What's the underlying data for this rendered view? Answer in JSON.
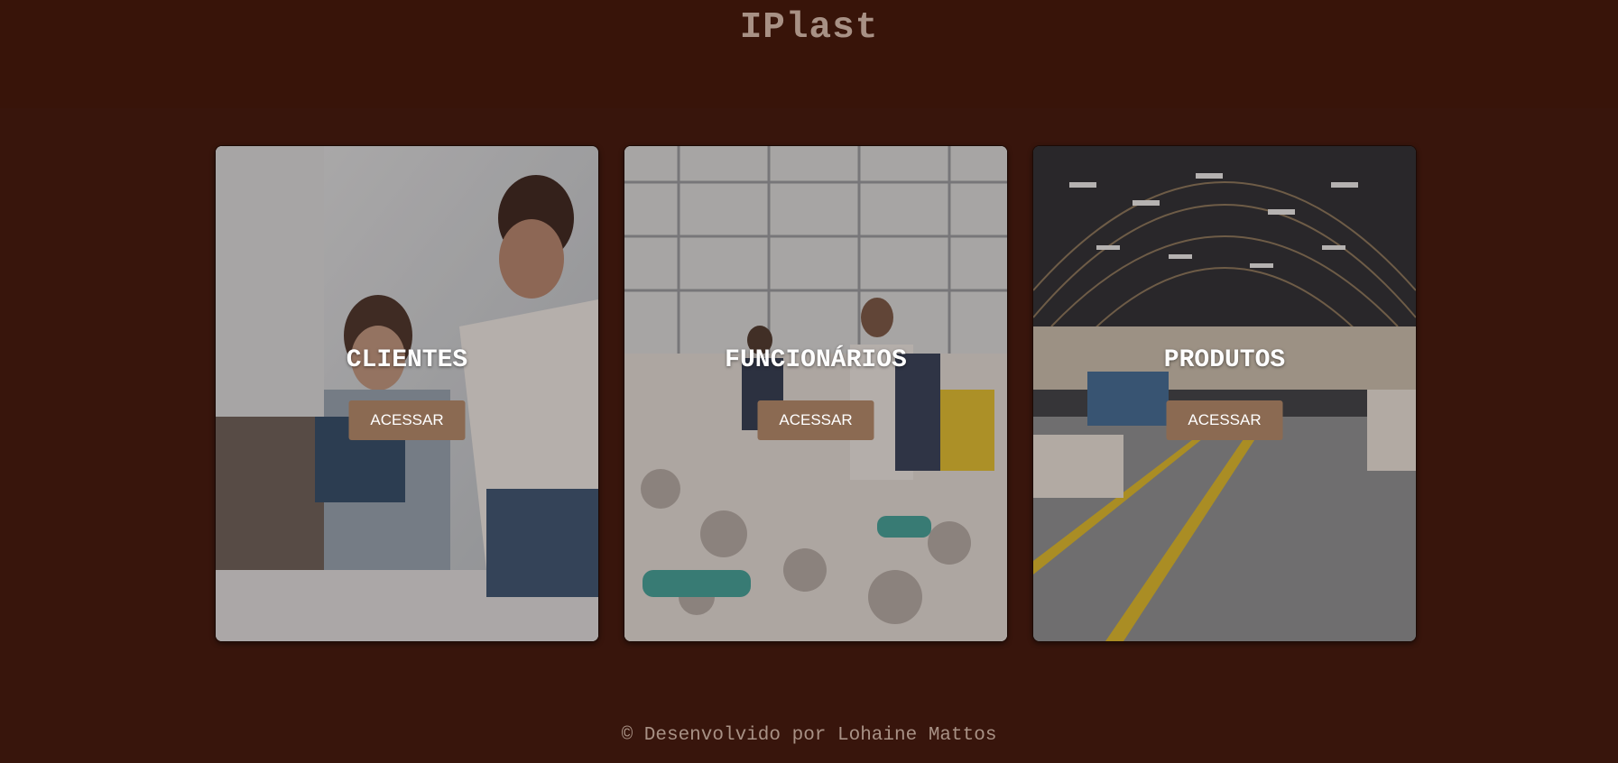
{
  "header": {
    "brand": "IPlast"
  },
  "cards": [
    {
      "title": "CLIENTES",
      "button_label": "ACESSAR",
      "image": "office-meeting-photo"
    },
    {
      "title": "FUNCIONÁRIOS",
      "button_label": "ACESSAR",
      "image": "recycling-workers-photo"
    },
    {
      "title": "PRODUTOS",
      "button_label": "ACESSAR",
      "image": "warehouse-photo"
    }
  ],
  "footer": {
    "text": "© Desenvolvido por Lohaine Mattos"
  },
  "colors": {
    "background": "#38150c",
    "header_background": "#381409",
    "button": "#8b6a52",
    "brand_text": "#a89185",
    "card_title": "#ffffff"
  }
}
